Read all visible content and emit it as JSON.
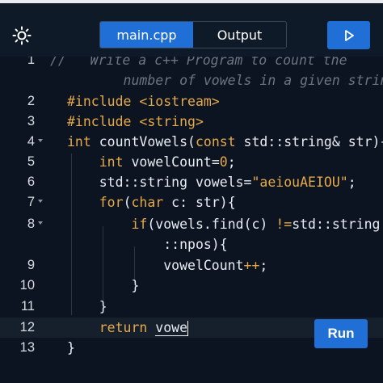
{
  "header": {
    "tabs": [
      {
        "label": "main.cpp",
        "active": true
      },
      {
        "label": "Output",
        "active": false
      }
    ],
    "brightness_icon": "sun-icon",
    "play_icon": "play-icon"
  },
  "editor": {
    "lines": [
      {
        "num": "1",
        "parts": [
          {
            "t": "//   Write a c++ Program to count the",
            "c": "comment"
          }
        ]
      },
      {
        "num": "",
        "parts": [
          {
            "t": "       number of vowels in a given string.",
            "c": "comment"
          }
        ]
      },
      {
        "num": "2",
        "parts": [
          {
            "t": "#include ",
            "c": "kw"
          },
          {
            "t": "<iostream>",
            "c": "str"
          }
        ]
      },
      {
        "num": "3",
        "parts": [
          {
            "t": "#include ",
            "c": "kw"
          },
          {
            "t": "<string>",
            "c": "str"
          }
        ]
      },
      {
        "num": "4",
        "parts": [
          {
            "t": "int",
            "c": "kw"
          },
          {
            "t": " countVowels(",
            "c": "plain"
          },
          {
            "t": "const",
            "c": "kw"
          },
          {
            "t": " std::string& str){",
            "c": "plain"
          }
        ]
      },
      {
        "num": "5",
        "parts": [
          {
            "t": "    ",
            "c": "plain"
          },
          {
            "t": "int",
            "c": "kw"
          },
          {
            "t": " vowelCount=",
            "c": "plain"
          },
          {
            "t": "0",
            "c": "num"
          },
          {
            "t": ";",
            "c": "plain"
          }
        ]
      },
      {
        "num": "6",
        "parts": [
          {
            "t": "    std::string vowels=",
            "c": "plain"
          },
          {
            "t": "\"aeiouAEIOU\"",
            "c": "str"
          },
          {
            "t": ";",
            "c": "plain"
          }
        ]
      },
      {
        "num": "7",
        "parts": [
          {
            "t": "    ",
            "c": "plain"
          },
          {
            "t": "for",
            "c": "kw"
          },
          {
            "t": "(",
            "c": "plain"
          },
          {
            "t": "char",
            "c": "kw"
          },
          {
            "t": " c: str){",
            "c": "plain"
          }
        ]
      },
      {
        "num": "8",
        "parts": [
          {
            "t": "        ",
            "c": "plain"
          },
          {
            "t": "if",
            "c": "kw"
          },
          {
            "t": "(vowels.find(c) ",
            "c": "plain"
          },
          {
            "t": "!=",
            "c": "kw"
          },
          {
            "t": "std::string",
            "c": "plain"
          }
        ]
      },
      {
        "num": "",
        "parts": [
          {
            "t": "            ::npos){",
            "c": "plain"
          }
        ]
      },
      {
        "num": "9",
        "parts": [
          {
            "t": "            vowelCount",
            "c": "plain"
          },
          {
            "t": "++",
            "c": "kw"
          },
          {
            "t": ";",
            "c": "plain"
          }
        ]
      },
      {
        "num": "10",
        "parts": [
          {
            "t": "        }",
            "c": "plain"
          }
        ]
      },
      {
        "num": "11",
        "parts": [
          {
            "t": "    }",
            "c": "plain"
          }
        ]
      },
      {
        "num": "12",
        "parts": [
          {
            "t": "    ",
            "c": "plain"
          },
          {
            "t": "return",
            "c": "kw"
          },
          {
            "t": " ",
            "c": "plain"
          },
          {
            "t": "vowe",
            "c": "cursor-word"
          }
        ]
      },
      {
        "num": "13",
        "parts": [
          {
            "t": "}",
            "c": "plain"
          }
        ]
      }
    ]
  },
  "run_button": {
    "label": "Run"
  }
}
